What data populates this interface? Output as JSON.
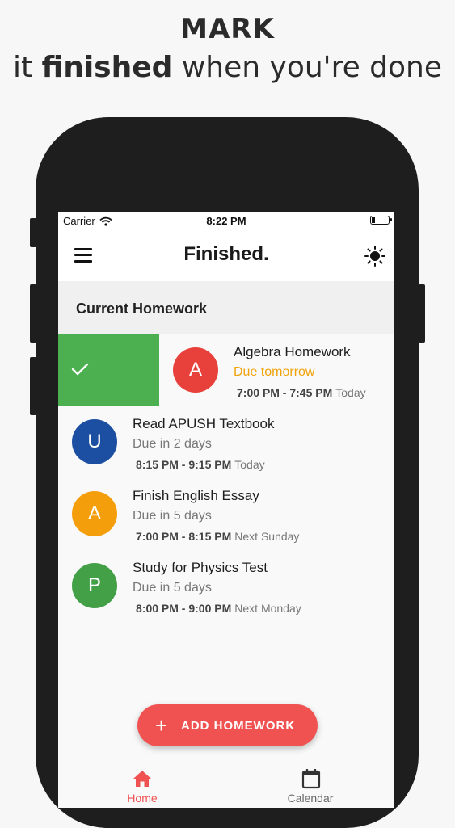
{
  "promo": {
    "line1": "MARK",
    "line2_pre": "it ",
    "line2_bold": "finished",
    "line2_post": " when you're done"
  },
  "status_bar": {
    "carrier": "Carrier",
    "time": "8:22 PM"
  },
  "app_bar": {
    "title": "Finished."
  },
  "section": {
    "title": "Current Homework"
  },
  "homework": [
    {
      "initial": "A",
      "title": "Algebra Homework",
      "due": "Due tomorrow",
      "time": "7:00 PM - 7:45 PM",
      "day": "Today",
      "color": "#e8403a",
      "due_color": "#f0a30a",
      "swiped": true
    },
    {
      "initial": "U",
      "title": "Read APUSH Textbook",
      "due": "Due in 2 days",
      "time": "8:15 PM - 9:15 PM",
      "day": "Today",
      "color": "#1c4ea1",
      "due_color": "#777777",
      "swiped": false
    },
    {
      "initial": "A",
      "title": "Finish English Essay",
      "due": "Due in 5 days",
      "time": "7:00 PM - 8:15 PM",
      "day": "Next Sunday",
      "color": "#f59e0b",
      "due_color": "#777777",
      "swiped": false
    },
    {
      "initial": "P",
      "title": "Study for Physics Test",
      "due": "Due in 5 days",
      "time": "8:00 PM - 9:00 PM",
      "day": "Next Monday",
      "color": "#43a047",
      "due_color": "#777777",
      "swiped": false
    }
  ],
  "fab": {
    "label": "ADD HOMEWORK"
  },
  "bottom_nav": {
    "home_label": "Home",
    "calendar_label": "Calendar",
    "active_color": "#f05252",
    "inactive_color": "#666666"
  }
}
